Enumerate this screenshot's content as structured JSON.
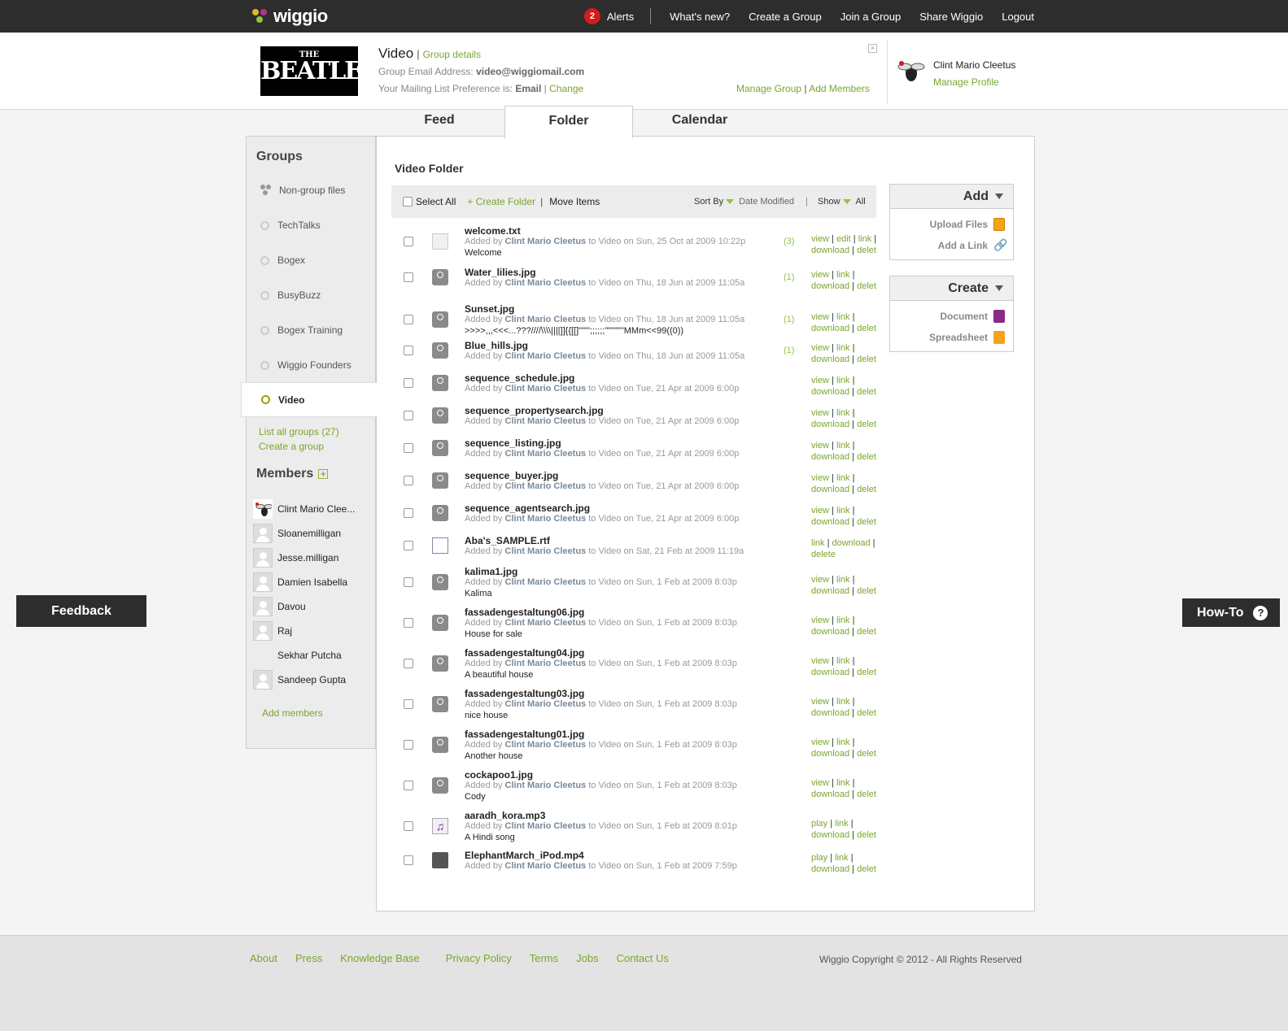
{
  "topbar": {
    "logo": "wiggio",
    "alert_count": "2",
    "nav": [
      "Alerts",
      "What's new?",
      "Create a Group",
      "Join a Group",
      "Share Wiggio",
      "Logout"
    ]
  },
  "group": {
    "logo_small": "THE",
    "logo_big": "BEATLES",
    "name": "Video",
    "details_link": "Group details",
    "email_label": "Group Email Address:",
    "email": "video@wiggiomail.com",
    "pref_label": "Your Mailing List Preference is:",
    "pref_value": "Email",
    "change_link": "Change",
    "manage_group": "Manage Group",
    "add_members": "Add Members"
  },
  "profile": {
    "name": "Clint Mario Cleetus",
    "manage": "Manage Profile"
  },
  "tabs": [
    "Feed",
    "Folder",
    "Calendar"
  ],
  "sidebar": {
    "groups_title": "Groups",
    "groups": [
      "Non-group files",
      "TechTalks",
      "Bogex",
      "BusyBuzz",
      "Bogex Training",
      "Wiggio Founders",
      "Video"
    ],
    "list_all": "List all groups (27)",
    "create_group": "Create a group",
    "members_title": "Members",
    "members": [
      "Clint Mario Clee...",
      "Sloanemilligan",
      "Jesse.milligan",
      "Damien Isabella",
      "Davou",
      "Raj",
      "Sekhar Putcha",
      "Sandeep Gupta"
    ],
    "add_members": "Add members"
  },
  "folder": {
    "title": "Video Folder",
    "select_all": "Select All",
    "create_folder": "+ Create Folder",
    "move_items": "Move Items",
    "sort_by": "Sort By",
    "sort_value": "Date Modified",
    "show": "Show",
    "show_value": "All",
    "added_by": "Added by",
    "author": "Clint Mario Cleetus",
    "files": [
      {
        "name": "welcome.txt",
        "date": "to Video on Sun, 25 Oct at 2009 10:22p",
        "desc": "Welcome",
        "count": "(3)",
        "icon": "text-file-icon",
        "actions1": "view | edit | link |",
        "actions2": "download | delet"
      },
      {
        "name": "Water_lilies.jpg",
        "date": "to Video on Thu, 18 Jun at 2009 11:05a",
        "desc": "",
        "count": "(1)",
        "icon": "camera-icon",
        "actions1": "view | link |",
        "actions2": "download | delet"
      },
      {
        "name": "Sunset.jpg",
        "date": "to Video on Thu, 18 Jun at 2009 11:05a",
        "desc": ">>>>,,,<<<...???////\\\\\\\\||||]]{{[[]\"\"\"';;;;;;\"\"\"\"\"\"MMm<<99((0))",
        "count": "(1)",
        "icon": "camera-icon",
        "actions1": "view | link |",
        "actions2": "download | delet"
      },
      {
        "name": "Blue_hills.jpg",
        "date": "to Video on Thu, 18 Jun at 2009 11:05a",
        "desc": "",
        "count": "(1)",
        "icon": "camera-icon",
        "actions1": "view | link |",
        "actions2": "download | delet"
      },
      {
        "name": "sequence_schedule.jpg",
        "date": "to Video on Tue, 21 Apr at 2009 6:00p",
        "desc": "",
        "count": "",
        "icon": "camera-icon",
        "actions1": "view | link |",
        "actions2": "download | delet"
      },
      {
        "name": "sequence_propertysearch.jpg",
        "date": "to Video on Tue, 21 Apr at 2009 6:00p",
        "desc": "",
        "count": "",
        "icon": "camera-icon",
        "actions1": "view | link |",
        "actions2": "download | delet"
      },
      {
        "name": "sequence_listing.jpg",
        "date": "to Video on Tue, 21 Apr at 2009 6:00p",
        "desc": "",
        "count": "",
        "icon": "camera-icon",
        "actions1": "view | link |",
        "actions2": "download | delet"
      },
      {
        "name": "sequence_buyer.jpg",
        "date": "to Video on Tue, 21 Apr at 2009 6:00p",
        "desc": "",
        "count": "",
        "icon": "camera-icon",
        "actions1": "view | link |",
        "actions2": "download | delet"
      },
      {
        "name": "sequence_agentsearch.jpg",
        "date": "to Video on Tue, 21 Apr at 2009 6:00p",
        "desc": "",
        "count": "",
        "icon": "camera-icon",
        "actions1": "view | link |",
        "actions2": "download | delet"
      },
      {
        "name": "Aba's_SAMPLE.rtf",
        "date": "to Video on Sat, 21 Feb at 2009 11:19a",
        "desc": "",
        "count": "",
        "icon": "document-icon",
        "actions1": "link | download |",
        "actions2": "delete"
      },
      {
        "name": "kalima1.jpg",
        "date": "to Video on Sun, 1 Feb at 2009 8:03p",
        "desc": "Kalima",
        "count": "",
        "icon": "camera-icon",
        "actions1": "view | link |",
        "actions2": "download | delet"
      },
      {
        "name": "fassadengestaltung06.jpg",
        "date": "to Video on Sun, 1 Feb at 2009 8:03p",
        "desc": "House for sale",
        "count": "",
        "icon": "camera-icon",
        "actions1": "view | link |",
        "actions2": "download | delet"
      },
      {
        "name": "fassadengestaltung04.jpg",
        "date": "to Video on Sun, 1 Feb at 2009 8:03p",
        "desc": "A beautiful house",
        "count": "",
        "icon": "camera-icon",
        "actions1": "view | link |",
        "actions2": "download | delet"
      },
      {
        "name": "fassadengestaltung03.jpg",
        "date": "to Video on Sun, 1 Feb at 2009 8:03p",
        "desc": "nice house",
        "count": "",
        "icon": "camera-icon",
        "actions1": "view | link |",
        "actions2": "download | delet"
      },
      {
        "name": "fassadengestaltung01.jpg",
        "date": "to Video on Sun, 1 Feb at 2009 8:03p",
        "desc": "Another house",
        "count": "",
        "icon": "camera-icon",
        "actions1": "view | link |",
        "actions2": "download | delet"
      },
      {
        "name": "cockapoo1.jpg",
        "date": "to Video on Sun, 1 Feb at 2009 8:03p",
        "desc": "Cody",
        "count": "",
        "icon": "camera-icon",
        "actions1": "view | link |",
        "actions2": "download | delet"
      },
      {
        "name": "aaradh_kora.mp3",
        "date": "to Video on Sun, 1 Feb at 2009 8:01p",
        "desc": "A Hindi song",
        "count": "",
        "icon": "music-icon",
        "actions1": "play | link |",
        "actions2": "download | delet"
      },
      {
        "name": "ElephantMarch_iPod.mp4",
        "date": "to Video on Sun, 1 Feb at 2009 7:59p",
        "desc": "",
        "count": "",
        "icon": "video-camera-icon",
        "actions1": "play | link |",
        "actions2": "download | delet"
      }
    ]
  },
  "add_box": {
    "title": "Add",
    "items": [
      "Upload Files",
      "Add a Link"
    ]
  },
  "create_box": {
    "title": "Create",
    "items": [
      "Document",
      "Spreadsheet"
    ]
  },
  "feedback": "Feedback",
  "howto": "How-To",
  "footer": {
    "links": [
      "About",
      "Press",
      "Knowledge Base",
      "Privacy Policy",
      "Terms",
      "Jobs",
      "Contact Us"
    ],
    "copyright": "Wiggio Copyright © 2012 - All Rights Reserved"
  },
  "colors": {
    "accent": "#7aa62c",
    "dark": "#2d2d2d",
    "alert": "#d31b1b"
  }
}
